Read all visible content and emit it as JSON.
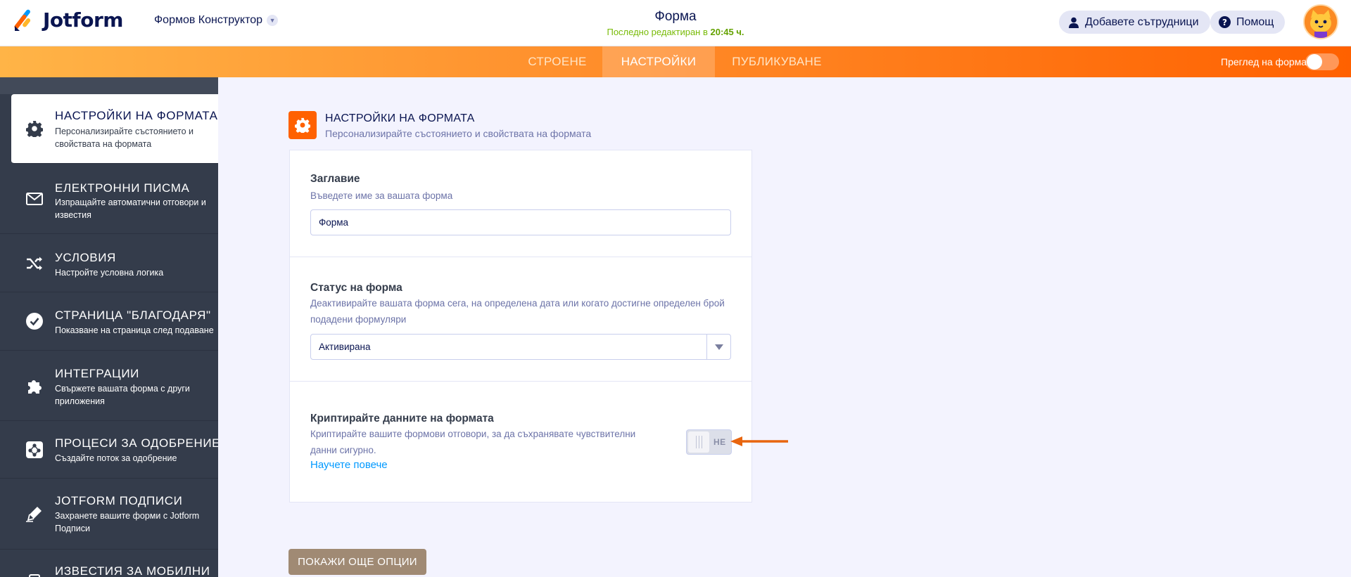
{
  "header": {
    "logo_text": "Jotform",
    "builder_label": "Формов Конструктор",
    "form_title": "Форма",
    "last_edited_prefix": "Последно редактиран в",
    "last_edited_time": "20:45 ч.",
    "add_collaborators": "Добавете сътрудници",
    "help": "Помощ"
  },
  "nav": {
    "tabs": [
      "СТРОЕНЕ",
      "НАСТРОЙКИ",
      "ПУБЛИКУВАНЕ"
    ],
    "active_tab": "НАСТРОЙКИ",
    "preview_label": "Преглед на форма",
    "preview_on": false
  },
  "sidebar": {
    "items": [
      {
        "title": "НАСТРОЙКИ НА ФОРМАТА",
        "desc": "Персонализирайте състоянието и свойствата на формата",
        "icon": "gear-icon",
        "active": true
      },
      {
        "title": "ЕЛЕКТРОННИ ПИСМА",
        "desc": "Изпращайте автоматични отговори и известия",
        "icon": "envelope-icon"
      },
      {
        "title": "УСЛОВИЯ",
        "desc": "Настройте условна логика",
        "icon": "shuffle-icon"
      },
      {
        "title": "СТРАНИЦА \"БЛАГОДАРЯ\"",
        "desc": "Показване на страница след подаване",
        "icon": "check-circle-icon"
      },
      {
        "title": "ИНТЕГРАЦИИ",
        "desc": "Свържете вашата форма с други приложения",
        "icon": "puzzle-icon"
      },
      {
        "title": "ПРОЦЕСИ ЗА ОДОБРЕНИЕ",
        "desc": "Създайте поток за одобрение",
        "icon": "approval-flow-icon"
      },
      {
        "title": "JOTFORM ПОДПИСИ",
        "desc": "Захранете вашите форми с Jotform Подписи",
        "icon": "pen-icon"
      },
      {
        "title": "ИЗВЕСТИЯ ЗА МОБИЛНИ",
        "desc": "",
        "icon": "mobile-icon"
      }
    ]
  },
  "main": {
    "section_title": "НАСТРОЙКИ НА ФОРМАТА",
    "section_sub": "Персонализирайте състоянието и свойствата на формата",
    "title_field": {
      "label": "Заглавие",
      "help": "Въведете име за вашата форма",
      "value": "Форма"
    },
    "status_field": {
      "label": "Статус на форма",
      "help": "Деактивирайте вашата форма сега, на определена дата или когато достигне определен брой подадени формуляри",
      "value": "Активирана"
    },
    "encrypt_field": {
      "label": "Криптирайте данните на формата",
      "help": "Криптирайте вашите формови отговори, за да съхранявате чувствителни данни сигурно.",
      "link": "Научете повече",
      "toggle_text": "НЕ",
      "enabled": false
    },
    "more_button": "ПОКАЖИ ОЩЕ ОПЦИИ"
  },
  "colors": {
    "accent": "#ff6100",
    "sidebar_bg": "#343c4b",
    "navy": "#0a1551",
    "link": "#0099ff",
    "annotation_arrow": "#e8650f"
  }
}
